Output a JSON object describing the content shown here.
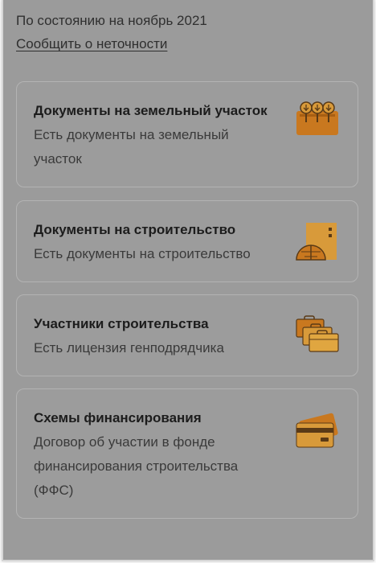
{
  "header": {
    "status_text": "По состоянию на ноябрь 2021",
    "report_link": "Сообщить о неточности"
  },
  "cards": [
    {
      "title": "Документы на земельный участок",
      "description": "Есть документы на земельный участок",
      "icon": "land-plot-icon"
    },
    {
      "title": "Документы на строительство",
      "description": "Есть документы на строительство",
      "icon": "construction-documents-icon"
    },
    {
      "title": "Участники строительства",
      "description": "Есть лицензия генподрядчика",
      "icon": "briefcases-icon"
    },
    {
      "title": "Схемы финансирования",
      "description": "Договор об участии в фонде финансирования строительства (ФФС)",
      "icon": "payment-cards-icon"
    }
  ],
  "colors": {
    "icon_primary": "#c9781f",
    "icon_secondary": "#d89a3a",
    "icon_dark": "#5a3a16"
  }
}
